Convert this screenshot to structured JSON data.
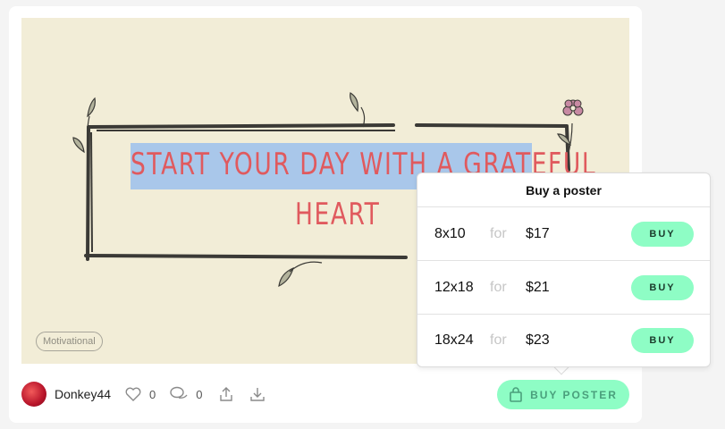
{
  "artwork": {
    "quote_line1": "START YOUR DAY WITH A GRATEFUL",
    "quote_line2": "HEART",
    "tag": "Motivational"
  },
  "footer": {
    "username": "Donkey44",
    "likes": "0",
    "comments": "0",
    "buy_poster_label": "BUY POSTER"
  },
  "popover": {
    "title": "Buy a poster",
    "for_label": "for",
    "buy_label": "BUY",
    "options": [
      {
        "size": "8x10",
        "price": "$17"
      },
      {
        "size": "12x18",
        "price": "$21"
      },
      {
        "size": "18x24",
        "price": "$23"
      }
    ]
  },
  "colors": {
    "accent": "#8efdc5",
    "quote": "#e05a5e",
    "highlight": "#a9c7ea",
    "canvas": "#f2edd7"
  },
  "icons": [
    "heart-icon",
    "comment-icon",
    "share-icon",
    "download-icon",
    "shopping-bag-icon",
    "flower-icon",
    "leaf-icon"
  ]
}
